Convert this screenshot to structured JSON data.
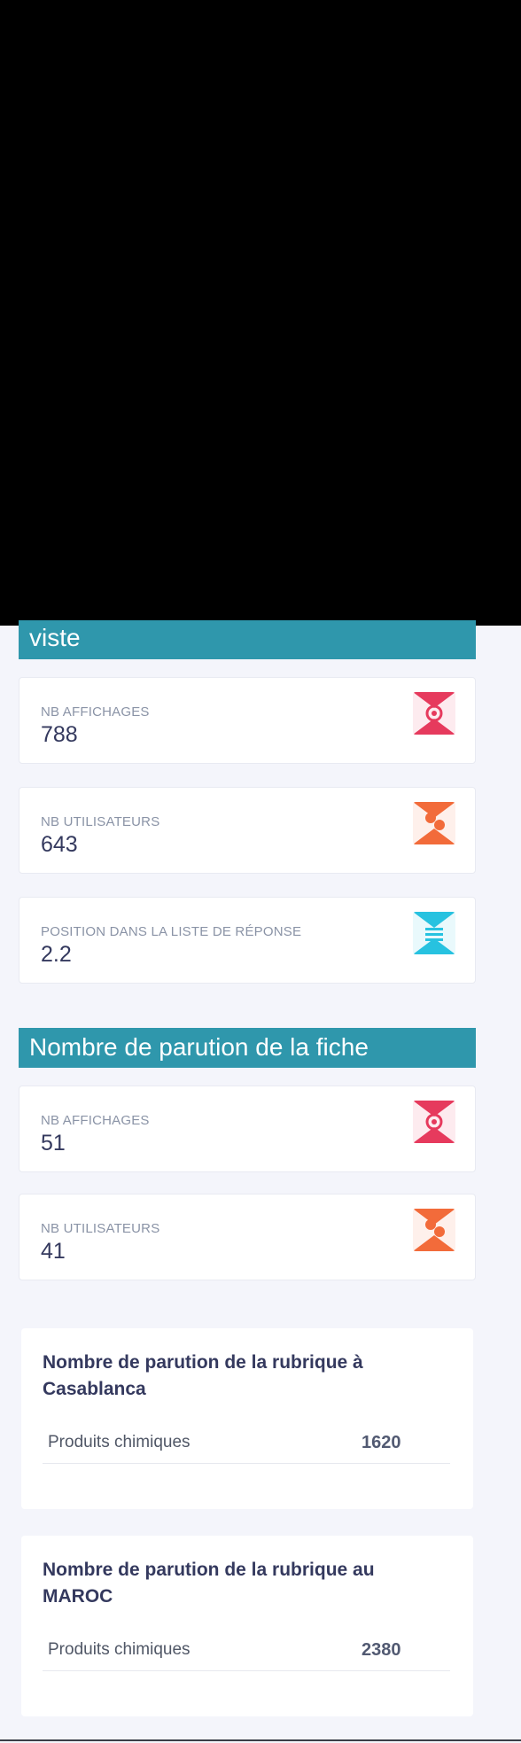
{
  "colors": {
    "section_header_bg": "#2f97ac",
    "eye_icon_bg": "#e63a5d",
    "users_icon_bg": "#f26b3a",
    "list_icon_bg": "#27c2e0"
  },
  "section1": {
    "title": "viste",
    "cards": [
      {
        "label": "NB AFFICHAGES",
        "value": "788",
        "icon": "eye-icon"
      },
      {
        "label": "NB UTILISATEURS",
        "value": "643",
        "icon": "users-icon"
      },
      {
        "label": "POSITION DANS LA LISTE DE RÉPONSE",
        "value": "2.2",
        "icon": "list-icon"
      }
    ]
  },
  "section2": {
    "title": "Nombre de parution de la fiche",
    "cards": [
      {
        "label": "NB AFFICHAGES",
        "value": "51",
        "icon": "eye-icon"
      },
      {
        "label": "NB UTILISATEURS",
        "value": "41",
        "icon": "users-icon"
      }
    ]
  },
  "table1": {
    "title": "Nombre de parution de la rubrique à Casablanca",
    "rows": [
      {
        "name": "Produits chimiques",
        "value": "1620"
      }
    ]
  },
  "table2": {
    "title": "Nombre de parution de la rubrique au MAROC",
    "rows": [
      {
        "name": "Produits chimiques",
        "value": "2380"
      }
    ]
  }
}
